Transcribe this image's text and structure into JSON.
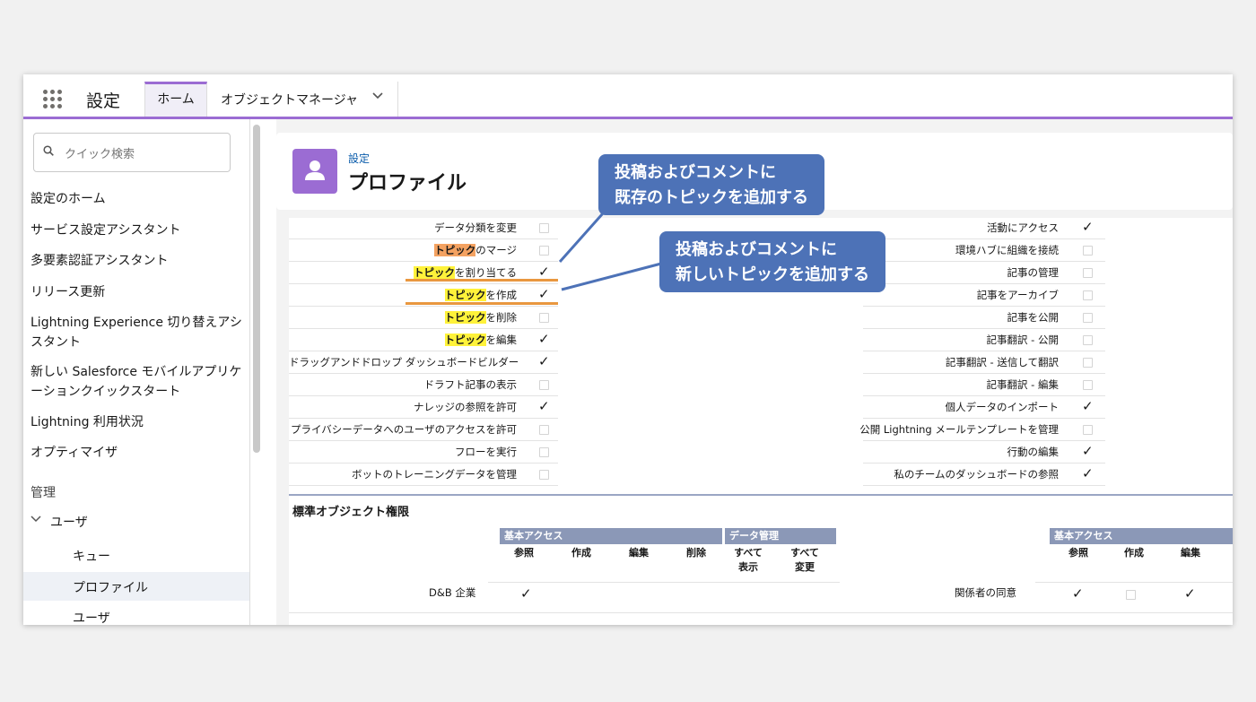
{
  "header": {
    "app_title": "設定",
    "tabs": [
      {
        "label": "ホーム",
        "active": true
      },
      {
        "label": "オブジェクトマネージャ",
        "active": false
      }
    ]
  },
  "sidebar": {
    "search_placeholder": "クイック検索",
    "items": [
      "設定のホーム",
      "サービス設定アシスタント",
      "多要素認証アシスタント",
      "リリース更新",
      "Lightning Experience 切り替えアシスタント",
      "新しい Salesforce モバイルアプリケーションクイックスタート",
      "Lightning 利用状況",
      "オプティマイザ"
    ],
    "section_label": "管理",
    "group_label": "ユーザ",
    "sub_items": [
      "キュー",
      "プロファイル",
      "ユーザ"
    ],
    "selected_sub_item": "プロファイル"
  },
  "page": {
    "breadcrumb": "設定",
    "title": "プロファイル"
  },
  "permissions": {
    "left": [
      {
        "label": "データ分類を変更",
        "checked": false
      },
      {
        "label_hl": "トピック",
        "label_rest": "のマージ",
        "hl": "orange",
        "checked": false
      },
      {
        "label_hl": "トピック",
        "label_rest": "を割り当てる",
        "hl": "yellow",
        "checked": true
      },
      {
        "label_hl": "トピック",
        "label_rest": "を作成",
        "hl": "yellow",
        "checked": true
      },
      {
        "label_hl": "トピック",
        "label_rest": "を削除",
        "hl": "yellow",
        "checked": false
      },
      {
        "label_hl": "トピック",
        "label_rest": "を編集",
        "hl": "yellow",
        "checked": true
      },
      {
        "label": "ドラッグアンドドロップ ダッシュボードビルダー",
        "checked": true
      },
      {
        "label": "ドラフト記事の表示",
        "checked": false
      },
      {
        "label": "ナレッジの参照を許可",
        "checked": true
      },
      {
        "label": "プライバシーデータへのユーザのアクセスを許可",
        "checked": false
      },
      {
        "label": "フローを実行",
        "checked": false
      },
      {
        "label": "ボットのトレーニングデータを管理",
        "checked": false
      }
    ],
    "right": [
      {
        "label": "活動にアクセス",
        "checked": true
      },
      {
        "label": "環境ハブに組織を接続",
        "checked": false
      },
      {
        "label": "記事の管理",
        "checked": false
      },
      {
        "label": "記事をアーカイブ",
        "checked": false
      },
      {
        "label": "記事を公開",
        "checked": false
      },
      {
        "label": "記事翻訳 - 公開",
        "checked": false
      },
      {
        "label": "記事翻訳 - 送信して翻訳",
        "checked": false
      },
      {
        "label": "記事翻訳 - 編集",
        "checked": false
      },
      {
        "label": "個人データのインポート",
        "checked": true
      },
      {
        "label": "公開 Lightning メールテンプレートを管理",
        "checked": false
      },
      {
        "label": "行動の編集",
        "checked": true
      },
      {
        "label": "私のチームのダッシュボードの参照",
        "checked": true
      }
    ]
  },
  "object_permissions": {
    "title": "標準オブジェクト権限",
    "left_groups": [
      "基本アクセス",
      "データ管理"
    ],
    "left_cols": [
      "参照",
      "作成",
      "編集",
      "削除",
      "すべて表示",
      "すべて変更"
    ],
    "right_groups": [
      "基本アクセス"
    ],
    "right_cols": [
      "参照",
      "作成",
      "編集"
    ],
    "left_row": {
      "label": "D&B 企業",
      "checks": [
        true
      ]
    },
    "right_row": {
      "label": "関係者の同意",
      "checks": [
        true,
        false,
        true
      ]
    }
  },
  "callouts": [
    {
      "line1": "投稿およびコメントに",
      "line2": "既存のトピックを追加する"
    },
    {
      "line1": "投稿およびコメントに",
      "line2": "新しいトピックを追加する"
    }
  ],
  "colors": {
    "accent_purple": "#9b6cd3",
    "callout_blue": "#4d72b7",
    "highlight_yellow": "#fff23a",
    "highlight_orange": "#f4a261",
    "underline_orange": "#e9973f"
  }
}
